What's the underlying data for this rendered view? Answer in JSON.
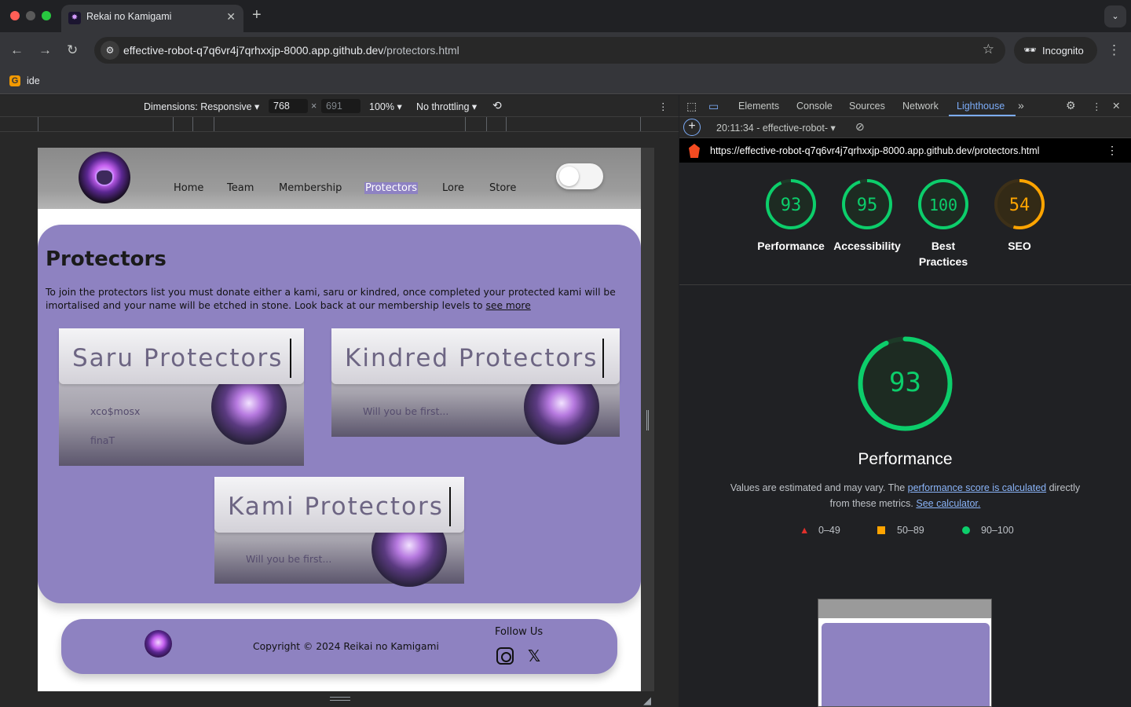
{
  "browser": {
    "tab_title": "Rekai no Kamigami",
    "url_host": "effective-robot-q7q6vr4j7qrhxxjp-8000.app.github.dev",
    "url_path": "/protectors.html",
    "incognito_label": "Incognito",
    "bookmark_label": "ide"
  },
  "device_toolbar": {
    "dimensions_label": "Dimensions: Responsive",
    "width": "768",
    "height": "691",
    "zoom": "100%",
    "throttling": "No throttling"
  },
  "site": {
    "nav": [
      "Home",
      "Team",
      "Membership",
      "Protectors",
      "Lore",
      "Store"
    ],
    "active_nav": "Protectors",
    "heading": "Protectors",
    "intro": "To join the protectors list you must donate either a kami, saru or kindred, once completed your protected kami will be imortalised and your name will be etched in stone. Look back at our membership levels to ",
    "intro_link": "see more",
    "cards": [
      {
        "title": "Saru Protectors",
        "names": [
          "xco$mosx",
          "finaT"
        ]
      },
      {
        "title": "Kindred Protectors",
        "names": [
          "Will you be first..."
        ]
      },
      {
        "title": "Kami Protectors",
        "names": [
          "Will you be first..."
        ]
      }
    ],
    "footer": {
      "copyright": "Copyright © 2024 Reikai no Kamigami",
      "follow": "Follow Us",
      "social_icons": [
        "instagram-icon",
        "x-icon"
      ]
    }
  },
  "devtools": {
    "tabs": [
      "Elements",
      "Console",
      "Sources",
      "Network",
      "Lighthouse"
    ],
    "active_tab": "Lighthouse",
    "report_select": "20:11:34 - effective-robot-",
    "report_url": "https://effective-robot-q7q6vr4j7qrhxxjp-8000.app.github.dev/protectors.html",
    "scores": [
      {
        "label": "Performance",
        "value": 93,
        "color": "#0cce6b"
      },
      {
        "label": "Accessibility",
        "value": 95,
        "color": "#0cce6b"
      },
      {
        "label": "Best Practices",
        "value": 100,
        "color": "#0cce6b"
      },
      {
        "label": "SEO",
        "value": 54,
        "color": "#ffa400"
      }
    ],
    "perf_title": "Performance",
    "perf_desc_1": "Values are estimated and may vary. The ",
    "perf_link_1": "performance score is calculated",
    "perf_desc_2": " directly from these metrics. ",
    "perf_link_2": "See calculator.",
    "legend": [
      "0–49",
      "50–89",
      "90–100"
    ]
  }
}
